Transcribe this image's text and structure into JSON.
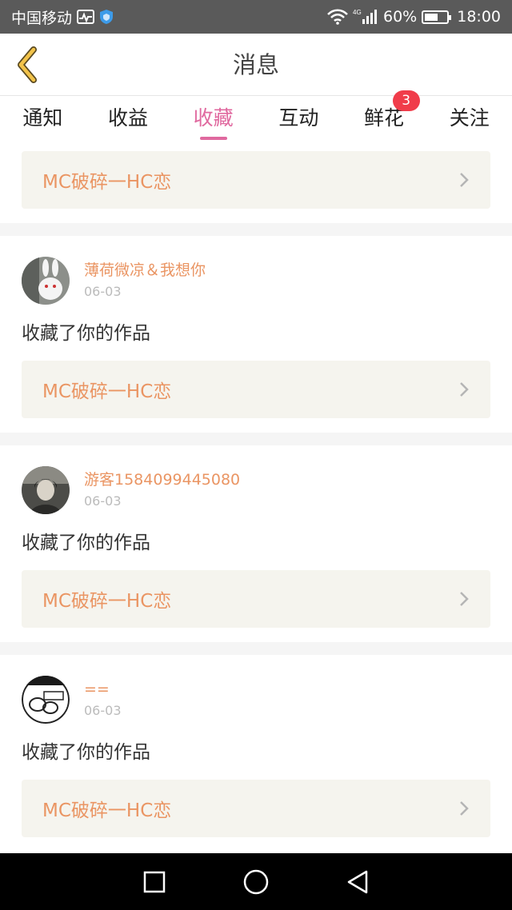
{
  "status_bar": {
    "carrier": "中国移动",
    "network": "4G",
    "battery": "60%",
    "battery_level": 0.6,
    "time": "18:00"
  },
  "header": {
    "title": "消息",
    "back_icon": "chevron-left-icon"
  },
  "tabs": [
    {
      "label": "通知"
    },
    {
      "label": "收益"
    },
    {
      "label": "收藏",
      "active": true
    },
    {
      "label": "互动"
    },
    {
      "label": "鲜花",
      "badge": "3"
    },
    {
      "label": "关注"
    }
  ],
  "feed": {
    "first_work": "MC破碎一HC恋",
    "messages": [
      {
        "username": "薄荷微凉＆我想你",
        "date": "06-03",
        "action": "收藏了你的作品",
        "work": "MC破碎一HC恋"
      },
      {
        "username": "游客1584099445080",
        "date": "06-03",
        "action": "收藏了你的作品",
        "work": "MC破碎一HC恋"
      },
      {
        "username": "==",
        "date": "06-03",
        "action": "收藏了你的作品",
        "work": "MC破碎一HC恋"
      }
    ]
  },
  "colors": {
    "accent_pink": "#e0699f",
    "work_orange": "#ea9563",
    "back_yellow": "#f2c34a",
    "badge_red": "#f03c4a"
  }
}
